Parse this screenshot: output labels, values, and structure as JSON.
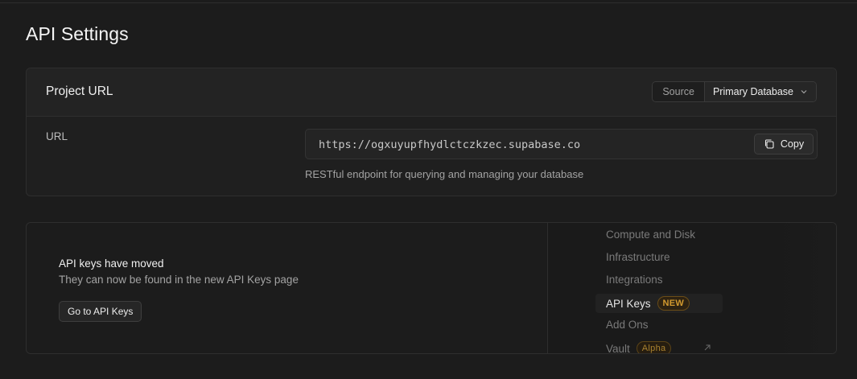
{
  "page": {
    "title": "API Settings"
  },
  "project_url": {
    "title": "Project URL",
    "source_label": "Source",
    "source_value": "Primary Database",
    "url_label": "URL",
    "url_value": "https://ogxuyupfhydlctczkzec.supabase.co",
    "copy_label": "Copy",
    "help_text": "RESTful endpoint for querying and managing your database"
  },
  "api_keys_notice": {
    "title": "API keys have moved",
    "description": "They can now be found in the new API Keys page",
    "button_label": "Go to API Keys"
  },
  "menu_preview": {
    "items": [
      {
        "label": "Compute and Disk"
      },
      {
        "label": "Infrastructure"
      },
      {
        "label": "Integrations"
      },
      {
        "label": "API Keys",
        "badge": "NEW"
      },
      {
        "label": "Add Ons"
      },
      {
        "label": "Vault",
        "badge": "Alpha"
      }
    ]
  },
  "colors": {
    "background": "#1c1c1c",
    "badge_new": "#d39a2f",
    "badge_alpha": "#a9822f"
  }
}
